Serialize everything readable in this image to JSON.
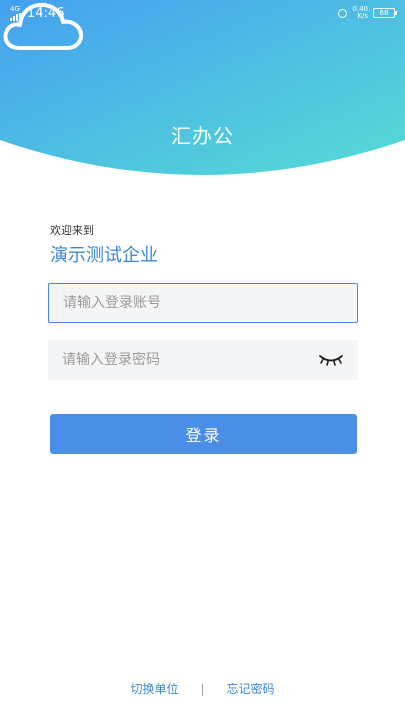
{
  "status_bar": {
    "network": "4G",
    "time": "14:46",
    "speed_value": "0.40",
    "speed_unit": "K/s",
    "battery": "68"
  },
  "header": {
    "app_name": "汇办公",
    "logo_icon": "cloud-icon",
    "gradient_start": "#4aa6f0",
    "gradient_end": "#56d9d6"
  },
  "welcome_text": "欢迎来到",
  "company_name": "演示测试企业",
  "account_field": {
    "placeholder": "请输入登录账号",
    "value": ""
  },
  "password_field": {
    "placeholder": "请输入登录密码",
    "value": "",
    "toggle_icon": "eye-closed-icon"
  },
  "login_button": {
    "label": "登录",
    "color": "#4a8ee8"
  },
  "footer": {
    "switch_unit": "切换单位",
    "separator": "|",
    "forgot_password": "忘记密码"
  }
}
